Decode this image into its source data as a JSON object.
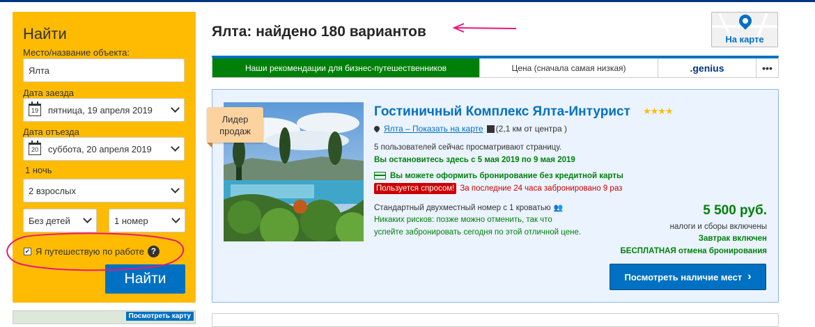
{
  "search": {
    "heading": "Найти",
    "destination_label": "Место/название объекта:",
    "destination_value": "Ялта",
    "checkin_label": "Дата заезда",
    "checkin_day": "19",
    "checkin_value": "пятница, 19 апреля 2019",
    "checkout_label": "Дата отъезда",
    "checkout_day": "20",
    "checkout_value": "суббота, 20 апреля 2019",
    "nights": "1 ночь",
    "adults": "2 взрослых",
    "children": "Без детей",
    "rooms": "1 номер",
    "business_trip_label": "Я путешествую по работе",
    "business_trip_checked": true,
    "help_glyph": "?",
    "check_glyph": "✔",
    "submit_label": "Найти",
    "mini_map_label": "Посмотреть карту"
  },
  "results": {
    "title": "Ялта: найдено 180 вариантов",
    "map_button_label": "На карте"
  },
  "sort_tabs": [
    {
      "label": "Наши рекомендации для бизнес-путешественников",
      "active": true
    },
    {
      "label": "Цена (сначала самая низкая)",
      "active": false
    },
    {
      "label": ".genius",
      "active": false
    },
    {
      "label": "•••",
      "active": false
    }
  ],
  "hotel": {
    "badge": "Лидер продаж",
    "name": "Гостиничный Комплекс Ялта-Интурист",
    "stars": "★★★★",
    "location_link": "Ялта – Показать на карте",
    "distance": "(2,1 км от центра )",
    "viewers": "5 пользователей сейчас просматривают страницу.",
    "stay_note": "Вы остановитесь здесь с 5 мая 2019 по 9 мая 2019",
    "no_card": "Вы можете оформить бронирование без кредитной карты",
    "demand_tag": "Пользуется спросом!",
    "demand_text": "За последние 24 часа забронировано 9 раз",
    "room": "Стандартный двухместный номер с 1 кроватью",
    "risk_line1": "Никаких рисков: позже можно отменить, так что",
    "risk_line2": "успейте забронировать сегодня по этой отличной цене.",
    "price": "5 500 руб.",
    "taxes": "налоги и сборы включены",
    "breakfast": "Завтрак включен",
    "free_cancel": "БЕСПЛАТНАЯ отмена бронирования",
    "cta": "Посмотреть наличие мест",
    "cta_chevron": "›",
    "people_glyph": "👥"
  },
  "colors": {
    "search_bg": "#febb02",
    "brand_blue": "#0071c2",
    "green": "#008009",
    "annotation_pink": "#e8177d"
  }
}
